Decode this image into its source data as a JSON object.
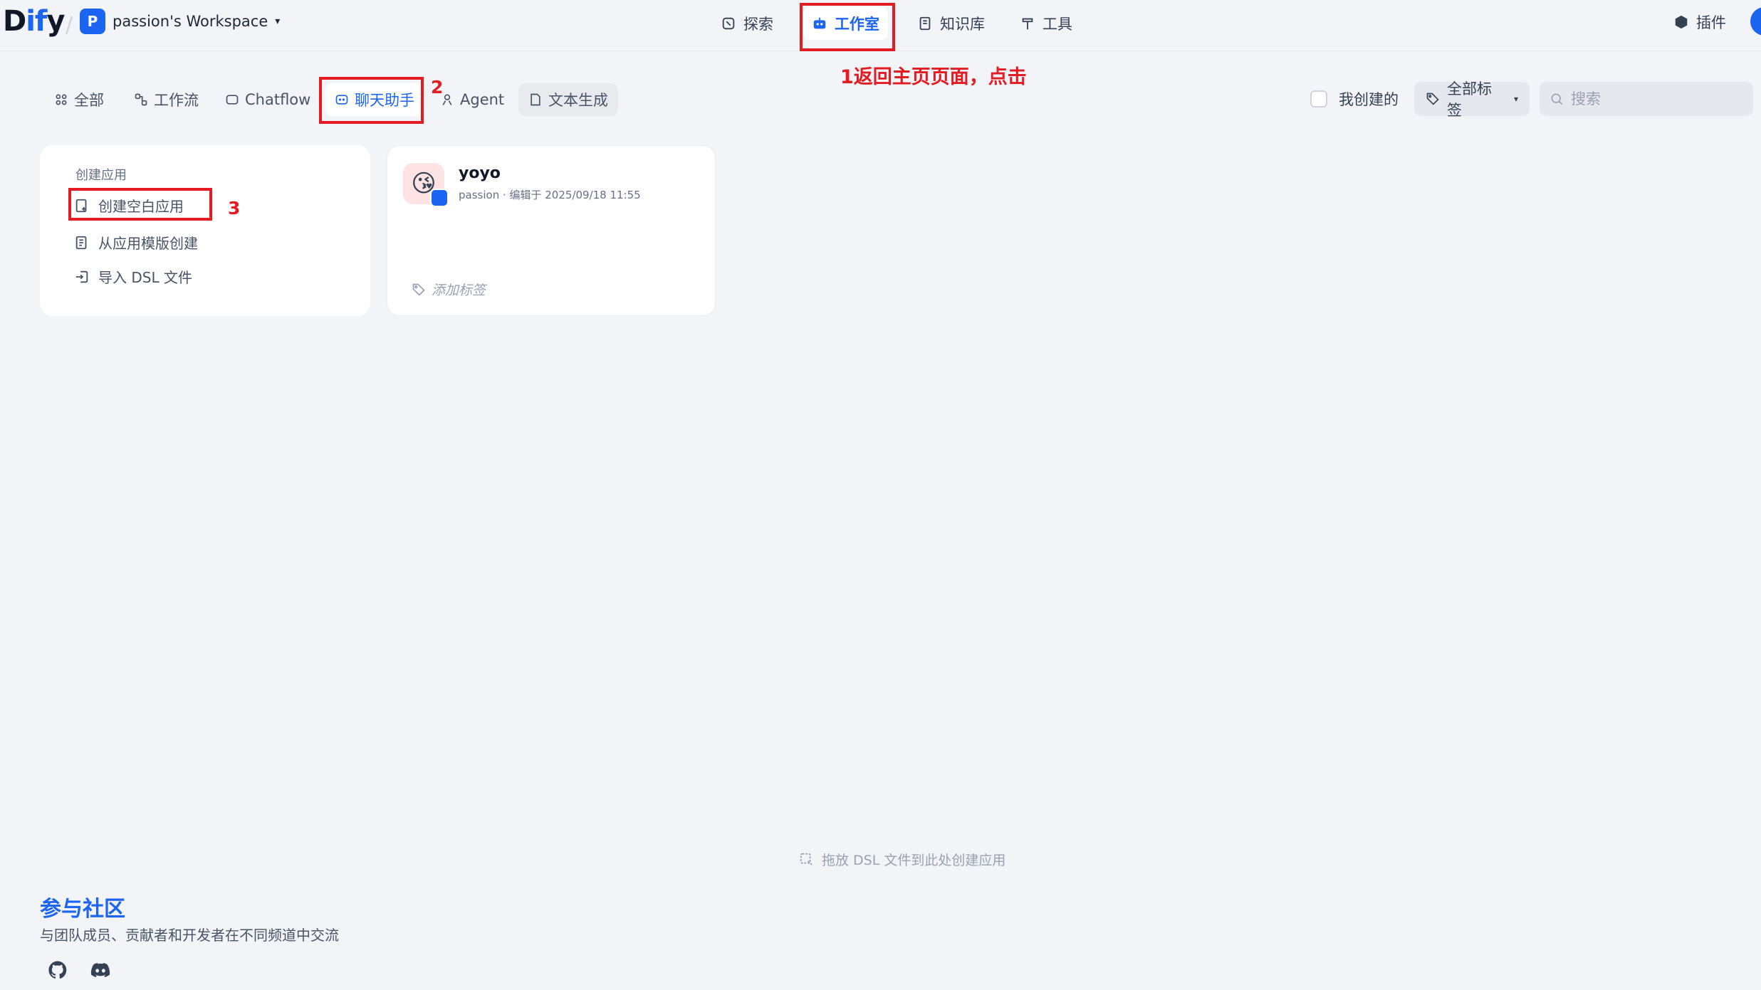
{
  "header": {
    "logo_left": "D",
    "logo_mid": "if",
    "logo_right": "y",
    "workspace_avatar": "P",
    "workspace_name": "passion's Workspace",
    "nav": {
      "explore": "探索",
      "studio": "工作室",
      "knowledge": "知识库",
      "tools": "工具"
    },
    "plugin": "插件"
  },
  "annotations": {
    "step1": "1返回主页页面，点击",
    "step2": "2",
    "step3": "3"
  },
  "filters": {
    "tabs": [
      "全部",
      "工作流",
      "Chatflow",
      "聊天助手",
      "Agent",
      "文本生成"
    ],
    "active": "聊天助手",
    "mine_label": "我创建的",
    "tags_label": "全部标签",
    "search_placeholder": "搜索"
  },
  "create": {
    "title": "创建应用",
    "items": [
      "创建空白应用",
      "从应用模版创建",
      "导入 DSL 文件"
    ]
  },
  "apps": [
    {
      "name": "yoyo",
      "meta": "passion · 编辑于 2025/09/18 11:55",
      "tag_placeholder": "添加标签",
      "icon": "😘"
    }
  ],
  "drop_hint": "拖放 DSL 文件到此处创建应用",
  "community": {
    "title": "参与社区",
    "desc": "与团队成员、贡献者和开发者在不同频道中交流"
  },
  "colors": {
    "accent": "#1c64f2",
    "annotation": "#e31b23",
    "background": "#f2f4f7"
  }
}
